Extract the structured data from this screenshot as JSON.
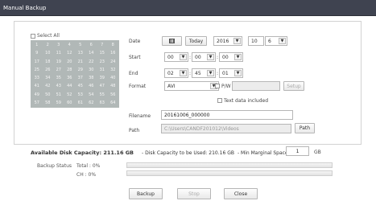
{
  "window": {
    "title": "Manual Backup"
  },
  "channels": {
    "select_all_label": "Select All",
    "cells": [
      "1",
      "2",
      "3",
      "4",
      "5",
      "6",
      "7",
      "8",
      "9",
      "10",
      "11",
      "12",
      "13",
      "14",
      "15",
      "16",
      "17",
      "18",
      "19",
      "20",
      "21",
      "22",
      "23",
      "24",
      "25",
      "26",
      "27",
      "28",
      "29",
      "30",
      "31",
      "32",
      "33",
      "34",
      "35",
      "36",
      "37",
      "38",
      "39",
      "40",
      "41",
      "42",
      "43",
      "44",
      "45",
      "46",
      "47",
      "48",
      "49",
      "50",
      "51",
      "52",
      "53",
      "54",
      "55",
      "56",
      "57",
      "58",
      "59",
      "60",
      "61",
      "62",
      "63",
      "64"
    ]
  },
  "date": {
    "label": "Date",
    "today_label": "Today",
    "year": "2016",
    "month": "10",
    "day": "6",
    "calendar_icon": "calendar-icon"
  },
  "start": {
    "label": "Start",
    "hour": "00",
    "minute": "00",
    "second": "00"
  },
  "end": {
    "label": "End",
    "hour": "02",
    "minute": "45",
    "second": "01"
  },
  "format": {
    "label": "Format",
    "value": "AVI",
    "pw_label": "P/W",
    "setup_label": "Setup",
    "text_data_label": "Text data included"
  },
  "filename": {
    "label": "Filename",
    "value": "20161006_000000"
  },
  "path": {
    "label": "Path",
    "value": "C:\\Users\\CANDF201012\\Videos",
    "button_label": "Path"
  },
  "capacity": {
    "available_label": "Available Disk Capacity: 211.16 GB",
    "to_be_used_label": "- Disk Capacity to be Used: 210.16 GB",
    "marginal_label": "- Min Marginal Space:",
    "marginal_value": "1",
    "marginal_unit": "GB"
  },
  "backup_status": {
    "label": "Backup Status",
    "total_label": "Total : 0%",
    "ch_label": "CH : 0%",
    "total_progress": 0,
    "ch_progress": 0
  },
  "buttons": {
    "backup": "Backup",
    "stop": "Stop",
    "close": "Close"
  },
  "colors": {
    "titlebar": "#3f4350",
    "grid": "#b1b8b7",
    "accent": "#6aa0d8"
  }
}
